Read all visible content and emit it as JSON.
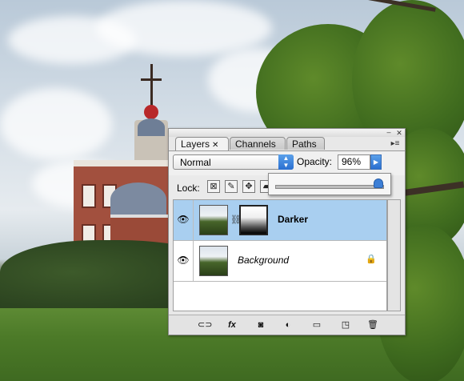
{
  "panel": {
    "tabs": [
      {
        "label": "Layers"
      },
      {
        "label": "Channels"
      },
      {
        "label": "Paths"
      }
    ],
    "tab_close": "✕",
    "window_close": "✕",
    "window_collapse": "–",
    "menu_icon": "▸≡"
  },
  "blend_mode": {
    "value": "Normal",
    "arrow": "▲▼"
  },
  "opacity": {
    "label": "Opacity:",
    "value": "96%",
    "slider_fraction": 0.96
  },
  "lock": {
    "label": "Lock:",
    "icons": [
      "transparent-pixels-lock-icon",
      "paint-brush-icon",
      "move-icon",
      "lock-all-icon"
    ]
  },
  "layers": [
    {
      "name": "Darker",
      "selected": true,
      "has_mask": true,
      "visible": true
    },
    {
      "name": "Background",
      "selected": false,
      "has_mask": false,
      "visible": true,
      "locked": true
    }
  ],
  "bottom_icons": [
    "link-layers-icon",
    "fx-icon",
    "add-mask-icon",
    "adjustment-layer-icon",
    "new-group-icon",
    "new-layer-icon",
    "trash-icon"
  ],
  "fx_label": "fx"
}
